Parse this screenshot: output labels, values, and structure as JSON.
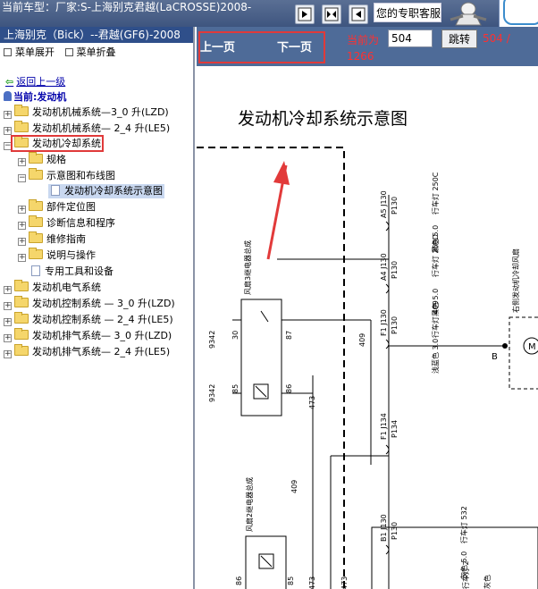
{
  "topbar": {
    "car_title": "当前车型：厂家:S-上海别克君越(LaCROSSE)2008-",
    "expert_label": "您的专职客服"
  },
  "left": {
    "header": "上海别克（Bick）--君越(GF6)-2008",
    "expand_label": "菜单展开",
    "collapse_label": "菜单折叠",
    "back_label": "返回上一级",
    "current_label": "当前:发动机",
    "tree": [
      {
        "label": "发动机机械系统—3_0 升(LZD)"
      },
      {
        "label": "发动机机械系统— 2_4 升(LE5)"
      },
      {
        "label": "发动机冷却系统"
      },
      {
        "label": "规格"
      },
      {
        "label": "示意图和布线图"
      },
      {
        "label": "发动机冷却系统示意图"
      },
      {
        "label": "部件定位图"
      },
      {
        "label": "诊断信息和程序"
      },
      {
        "label": "维修指南"
      },
      {
        "label": "说明与操作"
      },
      {
        "label": "专用工具和设备"
      },
      {
        "label": "发动机电气系统"
      },
      {
        "label": "发动机控制系统 — 3_0 升(LZD)"
      },
      {
        "label": "发动机控制系统 — 2_4 升(LE5)"
      },
      {
        "label": "发动机排气系统— 3_0 升(LZD)"
      },
      {
        "label": "发动机排气系统— 2_4 升(LE5)"
      }
    ]
  },
  "nav": {
    "prev": "上一页",
    "next": "下一页",
    "page_label": "当前为",
    "page_value": "504",
    "jump": "跳转",
    "page_count": "504 /",
    "page_total": "1266"
  },
  "diagram": {
    "title": "发动机冷却系统示意图",
    "relay3": "风扇3继电器总成",
    "relay2": "风扇2继电器总成",
    "motor": "右侧发动机冷却风扇",
    "pins": [
      "30",
      "87",
      "85",
      "86",
      "86",
      "85"
    ],
    "wires": [
      "9342",
      "9342",
      "409",
      "473",
      "409",
      "473",
      "473"
    ],
    "connector_codes": [
      "A5 J130",
      "A4 J130",
      "F1 J130",
      "F1 J134",
      "B1 J130"
    ],
    "circuits": [
      "P130",
      "P130",
      "P130",
      "P134",
      "P130"
    ],
    "wire_notes": [
      "行车灯 250C",
      "黑色 5.0",
      "行车灯 250D",
      "黑色 5.0",
      "行车灯 409",
      "浅蓝色 3.0",
      "行车灯 532",
      "灰色 5.0",
      "行车灯 2",
      "灰色"
    ],
    "node_b": "B"
  }
}
